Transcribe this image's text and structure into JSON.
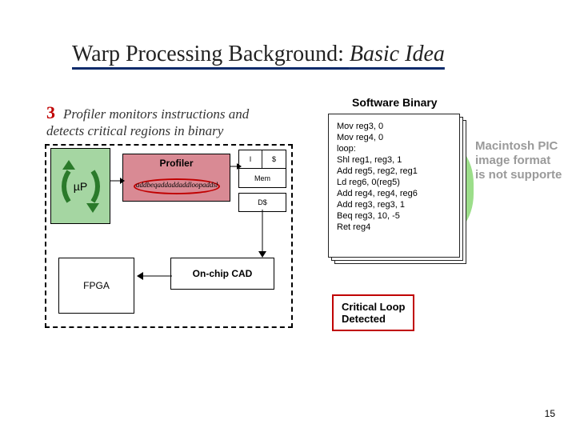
{
  "title": {
    "prefix": "Warp Processing Background: ",
    "suffix": "Basic Idea"
  },
  "callout": {
    "number": "3",
    "text": "Profiler monitors instructions and detects critical regions in binary"
  },
  "software_binary": {
    "heading": "Software Binary",
    "code": "Mov reg3, 0\nMov reg4, 0\nloop:\nShl reg1, reg3, 1\nAdd reg5, reg2, reg1\nLd reg6, 0(reg5)\nAdd reg4, reg4, reg6\nAdd reg3, reg3, 1\nBeq reg3, 10, -5\nRet reg4"
  },
  "unsupported": "Macintosh PIC\nimage format\nis not supporte",
  "chip": {
    "profiler_label": "Profiler",
    "profiler_scribble": "addbeqaddaddaddloopaddshl",
    "up_label": "µP",
    "i_cache": {
      "left": "I",
      "right": "$"
    },
    "mem_label": "Mem",
    "d_cache": "D$",
    "fpga_label": "FPGA",
    "cad_label": "On-chip CAD"
  },
  "detected_box": "Critical Loop\nDetected",
  "page_number": "15"
}
